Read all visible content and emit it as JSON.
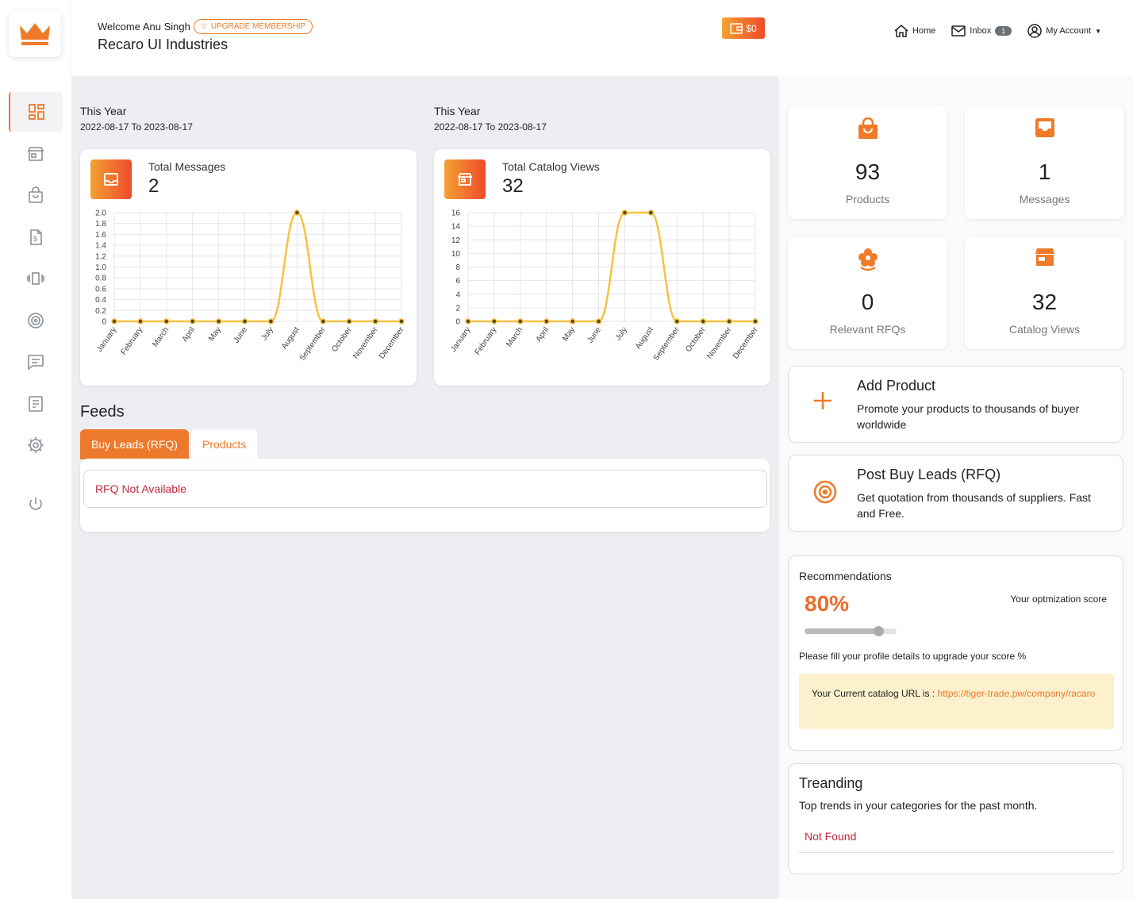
{
  "brand": {
    "accent": "#f07a28",
    "gradient_start": "#f4a233",
    "gradient_end": "#ee4a2c"
  },
  "header": {
    "welcome": "Welcome Anu Singh",
    "upgrade_label": "UPGRADE MEMBERSHIP",
    "company": "Recaro UI Industries",
    "wallet_amount": "$0",
    "nav": {
      "home": "Home",
      "inbox": "Inbox",
      "inbox_count": "1",
      "account": "My Account"
    }
  },
  "sidebar": {
    "items": [
      {
        "icon": "dashboard-icon",
        "active": true
      },
      {
        "icon": "store-icon",
        "active": false
      },
      {
        "icon": "shopping-bag-icon",
        "active": false
      },
      {
        "icon": "invoice-icon",
        "active": false
      },
      {
        "icon": "carousel-icon",
        "active": false
      },
      {
        "icon": "target-icon",
        "active": false
      },
      {
        "icon": "chat-icon",
        "active": false
      },
      {
        "icon": "form-icon",
        "active": false
      },
      {
        "icon": "settings-icon",
        "active": false
      },
      {
        "icon": "power-icon",
        "active": false
      }
    ]
  },
  "periods": [
    {
      "label": "This Year",
      "range": "2022-08-17 To 2023-08-17"
    },
    {
      "label": "This Year",
      "range": "2022-08-17 To 2023-08-17"
    }
  ],
  "stats_cards": [
    {
      "label": "Total Messages",
      "value": "2"
    },
    {
      "label": "Total Catalog Views",
      "value": "32"
    }
  ],
  "chart_data": [
    {
      "type": "line",
      "categories": [
        "January",
        "February",
        "March",
        "April",
        "May",
        "June",
        "July",
        "August",
        "September",
        "October",
        "November",
        "December"
      ],
      "series": [
        {
          "values": [
            0,
            0,
            0,
            0,
            0,
            0,
            0,
            2,
            0,
            0,
            0,
            0
          ]
        }
      ],
      "ylim": [
        0,
        2
      ],
      "yticks": [
        "0",
        "0.2",
        "0.4",
        "0.6",
        "0.8",
        "1.0",
        "1.2",
        "1.4",
        "1.6",
        "1.8",
        "2.0"
      ],
      "grid": true,
      "color": "#f5c242"
    },
    {
      "type": "line",
      "categories": [
        "January",
        "February",
        "March",
        "April",
        "May",
        "June",
        "July",
        "August",
        "September",
        "October",
        "November",
        "December"
      ],
      "series": [
        {
          "values": [
            0,
            0,
            0,
            0,
            0,
            0,
            16,
            16,
            0,
            0,
            0,
            0
          ]
        }
      ],
      "ylim": [
        0,
        16
      ],
      "yticks": [
        "0",
        "2",
        "4",
        "6",
        "8",
        "10",
        "12",
        "14",
        "16"
      ],
      "grid": true,
      "color": "#f5c242"
    }
  ],
  "feeds": {
    "title": "Feeds",
    "tabs": [
      {
        "label": "Buy Leads (RFQ)",
        "active": true
      },
      {
        "label": "Products",
        "active": false
      }
    ],
    "empty_message": "RFQ Not Available"
  },
  "summary": [
    {
      "value": "93",
      "label": "Products",
      "icon": "shopping-bag-icon"
    },
    {
      "value": "1",
      "label": "Messages",
      "icon": "inbox-icon"
    },
    {
      "value": "0",
      "label": "Relevant RFQs",
      "icon": "flower-icon"
    },
    {
      "value": "32",
      "label": "Catalog Views",
      "icon": "store-icon"
    }
  ],
  "actions": [
    {
      "title": "Add Product",
      "desc": "Promote your products to thousands of buyer worldwide",
      "icon": "plus-icon"
    },
    {
      "title": "Post Buy Leads (RFQ)",
      "desc": "Get quotation from thousands of suppliers. Fast and Free.",
      "icon": "target-icon"
    }
  ],
  "recommendations": {
    "title": "Recommendations",
    "score": "80%",
    "score_value": 0.8,
    "score_label": "Your optmization score",
    "hint": "Please fill your profile details to upgrade your score %",
    "url_label": "Your Current catalog URL is :",
    "url": "https://tiger-trade.pw/company/racaro"
  },
  "trending": {
    "title": "Treanding",
    "subtitle": "Top trends in your categories for the past month.",
    "empty": "Not Found"
  }
}
